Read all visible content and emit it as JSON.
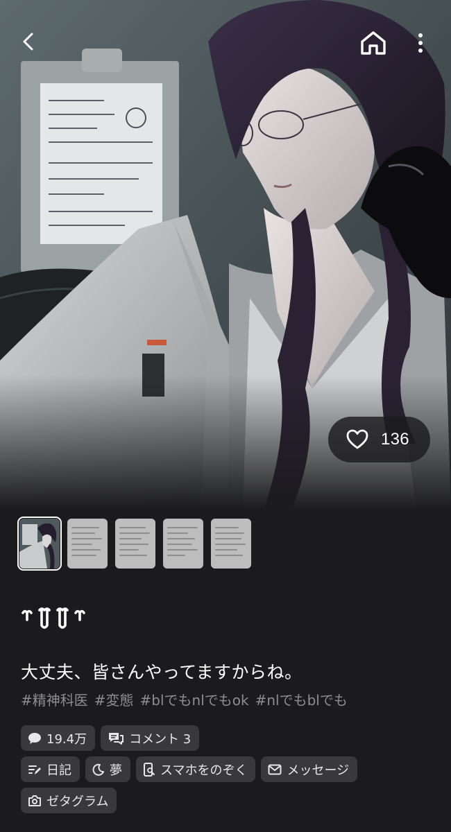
{
  "nav": {
    "back_icon": "chevron-left-icon",
    "home_icon": "home-icon",
    "more_icon": "more-vertical-icon"
  },
  "hero": {
    "like_icon": "heart-outline-icon",
    "like_count": "136"
  },
  "thumbnails": [
    {
      "kind": "portrait",
      "selected": true
    },
    {
      "kind": "note",
      "selected": false
    },
    {
      "kind": "note",
      "selected": false
    },
    {
      "kind": "note",
      "selected": false
    },
    {
      "kind": "note",
      "selected": false
    }
  ],
  "character": {
    "name_logo": "ヤヤヤ",
    "tagline": "大丈夫、皆さんやってますからね。",
    "hashtags": [
      "#精神科医",
      "#変態",
      "#blでもnlでもok",
      "#nlでもblでも"
    ]
  },
  "stats": {
    "chats": {
      "icon": "chat-bubble-icon",
      "label": "19.4万"
    },
    "comments": {
      "icon": "comments-icon",
      "label": "コメント 3"
    }
  },
  "actions": {
    "diary": {
      "icon": "note-edit-icon",
      "label": "日記"
    },
    "dream": {
      "icon": "moon-icon",
      "label": "夢"
    },
    "phone": {
      "icon": "phone-search-icon",
      "label": "スマホをのぞく"
    },
    "message": {
      "icon": "mail-icon",
      "label": "メッセージ"
    },
    "zetagram": {
      "icon": "camera-icon",
      "label": "ゼタグラム"
    }
  },
  "colors": {
    "background": "#1b1b1d",
    "chip": "#39393d",
    "hashtag": "#8e8e92",
    "hair": "#2a2233"
  }
}
